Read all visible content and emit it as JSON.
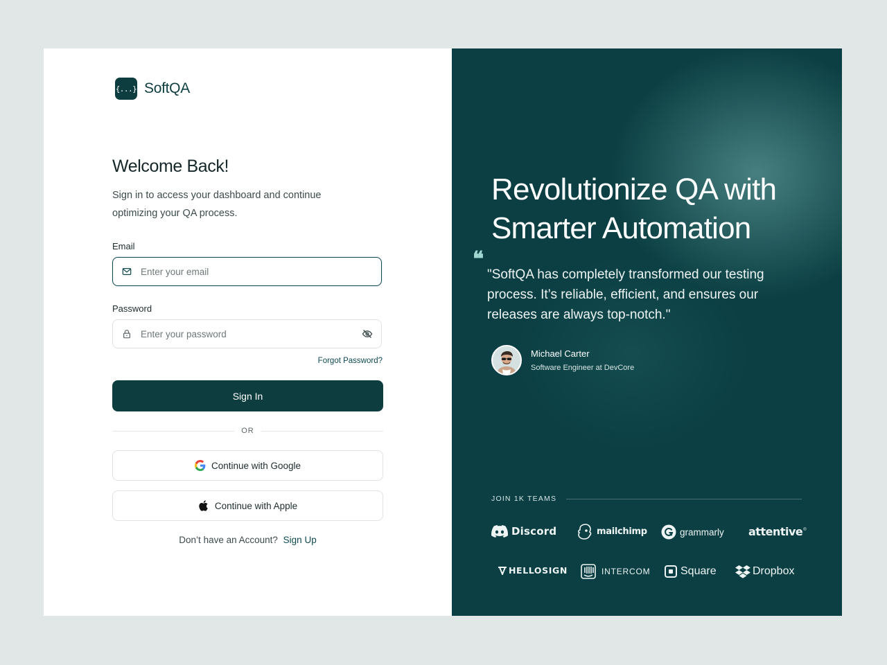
{
  "brand": {
    "logo_glyph": "{...}",
    "name": "SoftQA"
  },
  "login": {
    "title": "Welcome Back!",
    "subtitle": "Sign in to access your dashboard and continue optimizing your QA process.",
    "email_label": "Email",
    "email_placeholder": "Enter your email",
    "email_value": "",
    "password_label": "Password",
    "password_placeholder": "Enter your password",
    "password_value": "",
    "forgot_label": "Forgot Password?",
    "signin_label": "Sign In",
    "or_label": "OR",
    "google_label": "Continue with Google",
    "apple_label": "Continue with Apple",
    "no_account_text": "Don’t have an Account?",
    "signup_label": "Sign Up"
  },
  "promo": {
    "headline": "Revolutionize QA with Smarter Automation",
    "quote_mark": "❝",
    "quote": "\"SoftQA has completely transformed our testing process. It’s reliable, efficient, and ensures our releases are always top-notch.\"",
    "author_name": "Michael Carter",
    "author_role": "Software Engineer at DevCore",
    "join_label": "JOIN 1K TEAMS",
    "logos": [
      {
        "name": "Discord",
        "icon": "discord-icon"
      },
      {
        "name": "mailchimp",
        "icon": "mailchimp-icon"
      },
      {
        "name": "grammarly",
        "icon": "grammarly-icon"
      },
      {
        "name": "attentive",
        "icon": ""
      },
      {
        "name": "HELLOSIGN",
        "icon": "hellosign-icon"
      },
      {
        "name": "INTERCOM",
        "icon": "intercom-icon"
      },
      {
        "name": "Square",
        "icon": "square-icon"
      },
      {
        "name": "Dropbox",
        "icon": "dropbox-icon"
      }
    ]
  },
  "colors": {
    "primary": "#0e3d40",
    "panel_bg": "#0b3f43",
    "page_bg": "#e1e6e6",
    "accent_quote": "#9fd6d1"
  }
}
